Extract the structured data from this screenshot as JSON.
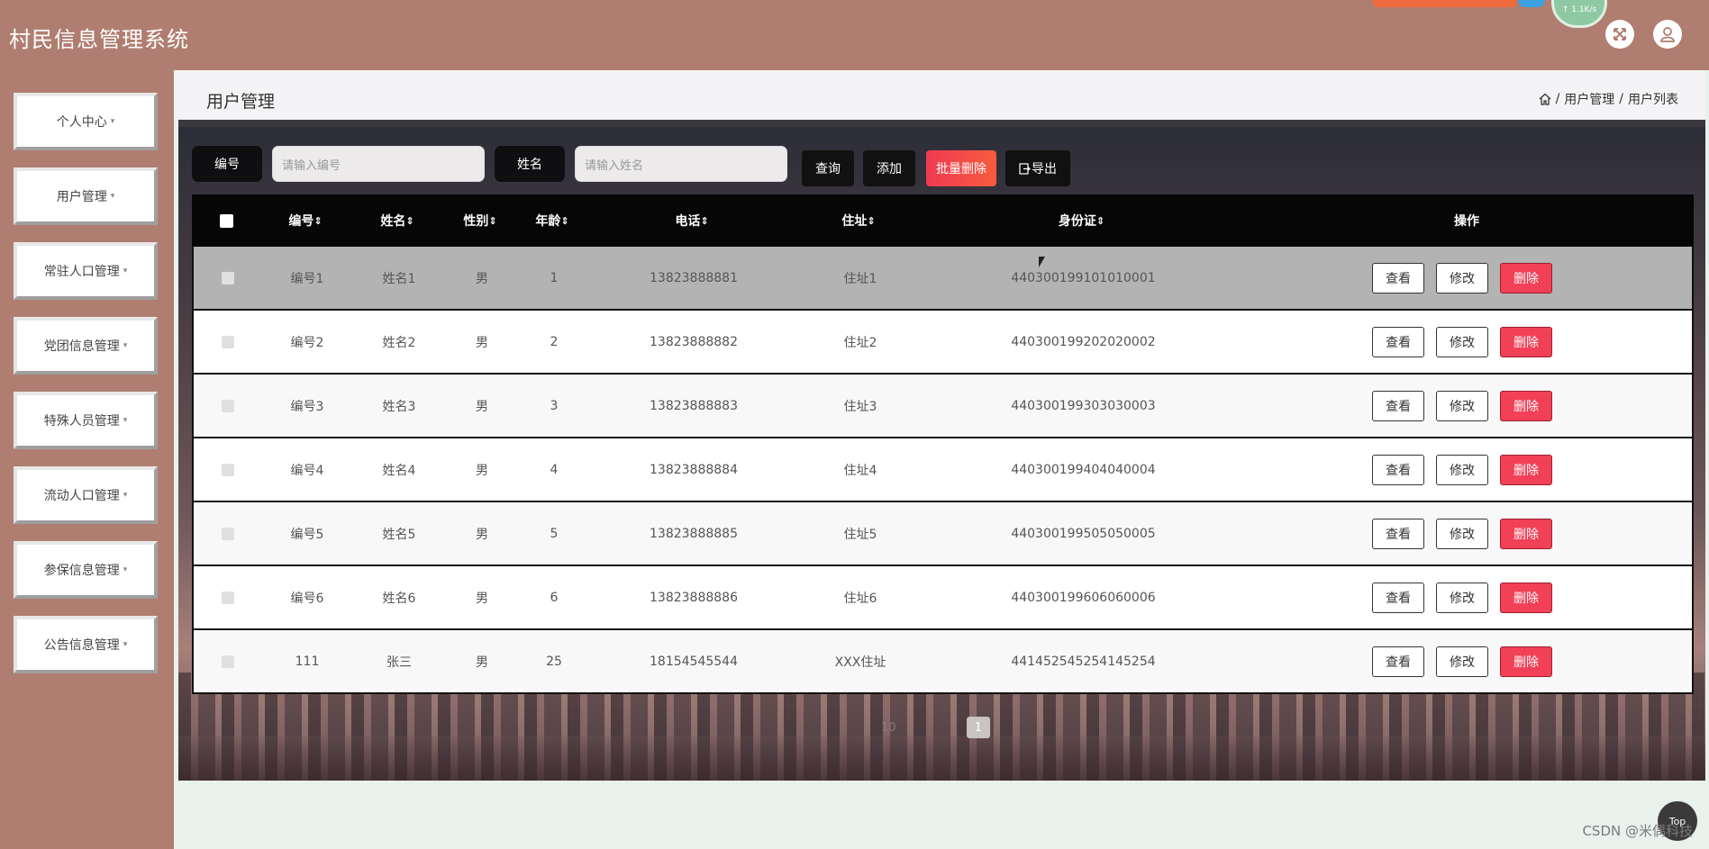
{
  "app": {
    "title": "村民信息管理系统"
  },
  "header": {
    "net_speed": "↑ 1.1K/s"
  },
  "sidebar": {
    "items": [
      {
        "label": "个人中心"
      },
      {
        "label": "用户管理"
      },
      {
        "label": "常驻人口管理"
      },
      {
        "label": "党团信息管理"
      },
      {
        "label": "特殊人员管理"
      },
      {
        "label": "流动人口管理"
      },
      {
        "label": "参保信息管理"
      },
      {
        "label": "公告信息管理"
      }
    ],
    "caret": "▾"
  },
  "page": {
    "title": "用户管理",
    "breadcrumb": [
      "用户管理",
      "用户列表"
    ],
    "breadcrumb_sep": "/"
  },
  "search": {
    "id_label": "编号",
    "id_placeholder": "请输入编号",
    "name_label": "姓名",
    "name_placeholder": "请输入姓名",
    "query_label": "查询",
    "add_label": "添加",
    "batch_delete_label": "批量删除",
    "export_label": "导出"
  },
  "table": {
    "columns": [
      "编号",
      "姓名",
      "性别",
      "年龄",
      "电话",
      "住址",
      "身份证",
      "操作"
    ],
    "sort_glyph": "⇕",
    "rows": [
      {
        "id": "编号1",
        "name": "姓名1",
        "gender": "男",
        "age": "1",
        "phone": "13823888881",
        "address": "住址1",
        "idcard": "440300199101010001"
      },
      {
        "id": "编号2",
        "name": "姓名2",
        "gender": "男",
        "age": "2",
        "phone": "13823888882",
        "address": "住址2",
        "idcard": "440300199202020002"
      },
      {
        "id": "编号3",
        "name": "姓名3",
        "gender": "男",
        "age": "3",
        "phone": "13823888883",
        "address": "住址3",
        "idcard": "440300199303030003"
      },
      {
        "id": "编号4",
        "name": "姓名4",
        "gender": "男",
        "age": "4",
        "phone": "13823888884",
        "address": "住址4",
        "idcard": "440300199404040004"
      },
      {
        "id": "编号5",
        "name": "姓名5",
        "gender": "男",
        "age": "5",
        "phone": "13823888885",
        "address": "住址5",
        "idcard": "440300199505050005"
      },
      {
        "id": "编号6",
        "name": "姓名6",
        "gender": "男",
        "age": "6",
        "phone": "13823888886",
        "address": "住址6",
        "idcard": "440300199606060006"
      },
      {
        "id": "111",
        "name": "张三",
        "gender": "男",
        "age": "25",
        "phone": "18154545544",
        "address": "XXX住址",
        "idcard": "441452545254145254"
      }
    ],
    "actions": {
      "view": "查看",
      "edit": "修改",
      "delete": "删除"
    }
  },
  "pagination": {
    "page_size": "10",
    "current_page": "1"
  },
  "misc": {
    "top_button": "Top",
    "watermark": "CSDN @米偶科技"
  },
  "colors": {
    "brand": "#b07e70",
    "danger": "#f24157",
    "dark": "#111111"
  }
}
